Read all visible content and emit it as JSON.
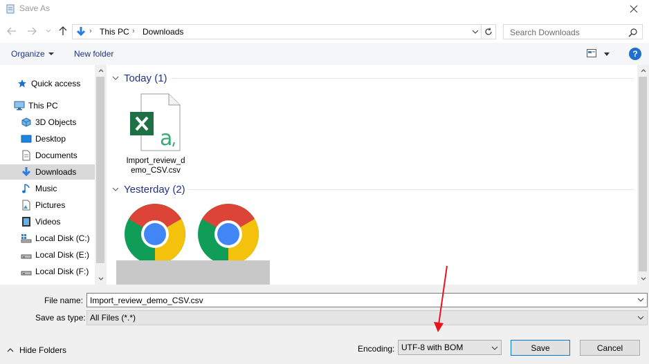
{
  "window": {
    "title": "Save As"
  },
  "address": {
    "crumbs": [
      "This PC",
      "Downloads"
    ],
    "search_placeholder": "Search Downloads"
  },
  "toolbar": {
    "organize": "Organize",
    "new_folder": "New folder",
    "help": "?"
  },
  "nav": {
    "items": [
      {
        "label": "Quick access",
        "icon": "star-icon"
      },
      {
        "label": "This PC",
        "icon": "monitor-icon"
      },
      {
        "label": "3D Objects",
        "icon": "cube-icon"
      },
      {
        "label": "Desktop",
        "icon": "desktop-icon"
      },
      {
        "label": "Documents",
        "icon": "document-icon"
      },
      {
        "label": "Downloads",
        "icon": "download-icon",
        "selected": true
      },
      {
        "label": "Music",
        "icon": "music-icon"
      },
      {
        "label": "Pictures",
        "icon": "pictures-icon"
      },
      {
        "label": "Videos",
        "icon": "video-icon"
      },
      {
        "label": "Local Disk (C:)",
        "icon": "drive-icon"
      },
      {
        "label": "Local Disk (E:)",
        "icon": "drive-icon"
      },
      {
        "label": "Local Disk (F:)",
        "icon": "drive-icon"
      }
    ]
  },
  "files": {
    "groups": [
      {
        "title": "Today (1)"
      },
      {
        "title": "Yesterday (2)"
      }
    ],
    "today_file_name_line1": "Import_review_d",
    "today_file_name_line2": "emo_CSV.csv"
  },
  "form": {
    "file_name_label": "File name:",
    "file_name_value": "Import_review_demo_CSV.csv",
    "save_type_label": "Save as type:",
    "save_type_value": "All Files  (*.*)",
    "encoding_label": "Encoding:",
    "encoding_value": "UTF-8 with BOM",
    "save_button": "Save",
    "cancel_button": "Cancel",
    "hide_folders": "Hide Folders"
  },
  "colors": {
    "accent": "#0078d7",
    "link": "#1e3287",
    "annotation_arrow": "#e8141b",
    "excel_green": "#1e7145",
    "chrome_red": "#db4437",
    "chrome_yellow": "#f4c20d",
    "chrome_green": "#0f9d58",
    "chrome_blue": "#4285f4"
  }
}
